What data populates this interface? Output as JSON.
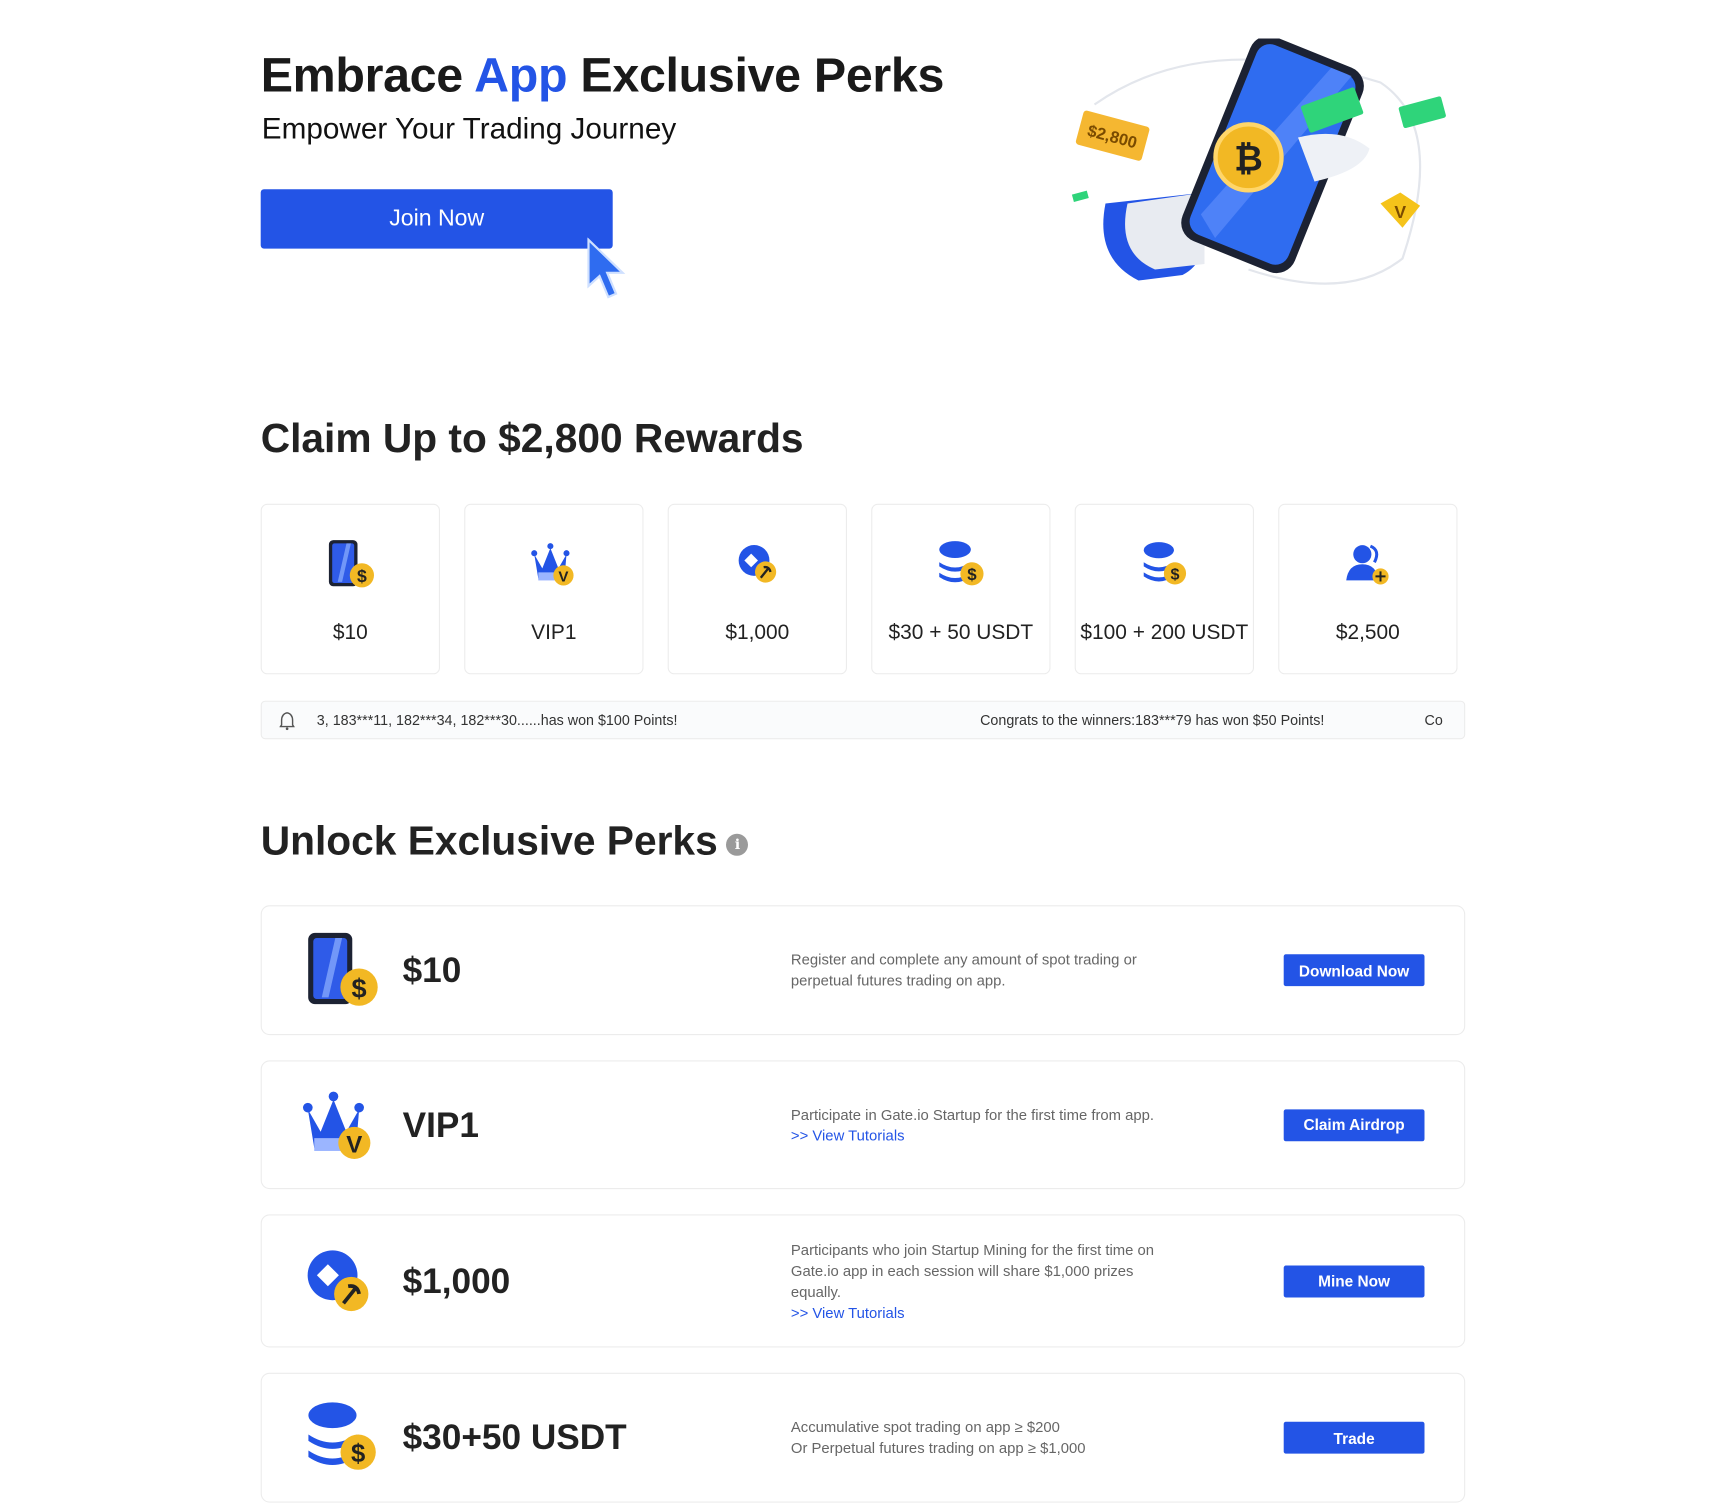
{
  "hero": {
    "title_part1": "Embrace ",
    "title_accent": "App",
    "title_part2": " Exclusive Perks",
    "subtitle": "Empower Your Trading Journey",
    "join_label": "Join Now",
    "illustration_badge": "$2,800"
  },
  "claim": {
    "heading": "Claim Up to $2,800 Rewards",
    "cards": [
      {
        "icon": "phone-coin-icon",
        "label": "$10"
      },
      {
        "icon": "crown-vip-icon",
        "label": "VIP1"
      },
      {
        "icon": "mining-icon",
        "label": "$1,000"
      },
      {
        "icon": "coin-stack-icon",
        "label": "$30 + 50 USDT"
      },
      {
        "icon": "coin-stack-icon",
        "label": "$100 + 200 USDT"
      },
      {
        "icon": "user-add-icon",
        "label": "$2,500"
      }
    ]
  },
  "ticker": {
    "items": [
      "3, 183***11, 182***34, 182***30......has won $100 Points!",
      "Congrats to the winners:183***79 has won $50 Points!",
      "Co"
    ]
  },
  "unlock": {
    "heading": "Unlock Exclusive Perks",
    "perks": [
      {
        "icon": "phone-coin-icon",
        "amount": "$10",
        "desc": "Register and complete any amount of spot trading or perpetual futures trading on app.",
        "link": "",
        "button": "Download Now"
      },
      {
        "icon": "crown-vip-icon",
        "amount": "VIP1",
        "desc": "Participate in Gate.io Startup for the first time from app.",
        "link": ">> View Tutorials",
        "button": "Claim Airdrop"
      },
      {
        "icon": "mining-icon",
        "amount": "$1,000",
        "desc": "Participants who join Startup Mining for the first time on Gate.io app in each session will share $1,000 prizes equally.",
        "link": ">> View Tutorials",
        "button": "Mine Now"
      },
      {
        "icon": "coin-stack-icon",
        "amount": "$30+50 USDT",
        "desc_line1": "Accumulative spot trading on app ≥ $200",
        "desc_line2": "Or Perpetual futures trading on app ≥ $1,000",
        "button": "Trade"
      }
    ]
  },
  "colors": {
    "accent": "#2354e6",
    "coin": "#f2b824"
  }
}
